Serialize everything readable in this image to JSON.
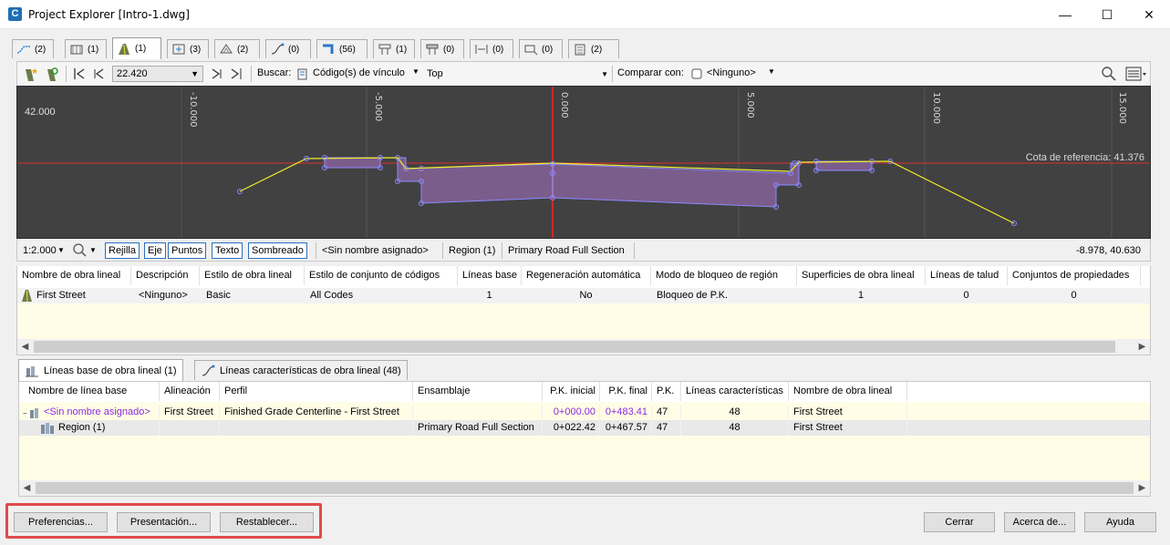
{
  "window": {
    "title": "Project Explorer [Intro-1.dwg]",
    "app_icon": "C"
  },
  "tabs": [
    {
      "icon": "alignment-icon",
      "count": "(2)"
    },
    {
      "icon": "profile-view-icon",
      "count": "(1)"
    },
    {
      "icon": "corridor-icon",
      "count": "(1)"
    },
    {
      "icon": "assembly-icon",
      "count": "(3)"
    },
    {
      "icon": "surface-icon",
      "count": "(2)"
    },
    {
      "icon": "feature-line-icon",
      "count": "(0)"
    },
    {
      "icon": "point-icon",
      "count": "(56)"
    },
    {
      "icon": "pipe-network-icon",
      "count": "(1)"
    },
    {
      "icon": "pressure-network-icon",
      "count": "(0)"
    },
    {
      "icon": "sample-line-icon",
      "count": "(0)"
    },
    {
      "icon": "parcel-icon",
      "count": "(0)"
    },
    {
      "icon": "catalog-icon",
      "count": "(2)"
    }
  ],
  "toolbar": {
    "station_value": "22.420",
    "search_label": "Buscar:",
    "search_mode": "Código(s) de vínculo",
    "search_value": "Top",
    "compare_label": "Comparar con:",
    "compare_value": "<Ninguno>"
  },
  "viewer": {
    "axis_labels": [
      "-10.000",
      "-5.000",
      "0.000",
      "5.000",
      "10.000",
      "15.000"
    ],
    "elevation_label": "42.000",
    "reference_label": "Cota de referencia: 41.376"
  },
  "viewbar": {
    "scale": "1:2.000",
    "toggles": [
      "Rejilla",
      "Eje",
      "Puntos",
      "Texto",
      "Sombreado"
    ],
    "baseline": "<Sin nombre asignado>",
    "region": "Region (1)",
    "assembly": "Primary Road Full Section",
    "coords": "-8.978, 40.630"
  },
  "corridor_table": {
    "headers": [
      "Nombre de obra lineal",
      "Descripción",
      "Estilo de obra lineal",
      "Estilo de conjunto de códigos",
      "Líneas base",
      "Regeneración automática",
      "Modo de bloqueo de región",
      "Superficies de obra lineal",
      "Líneas de talud",
      "Conjuntos de propiedades"
    ],
    "rows": [
      [
        "First Street",
        "<Ninguno>",
        "Basic",
        "All Codes",
        "1",
        "No",
        "Bloqueo de P.K.",
        "1",
        "0",
        "0"
      ]
    ]
  },
  "lower_tabs": [
    {
      "label": "Líneas base de obra lineal (1)"
    },
    {
      "label": "Líneas características de obra lineal (48)"
    }
  ],
  "baseline_table": {
    "headers": [
      "Nombre de línea base",
      "Alineación",
      "Perfil",
      "Ensamblaje",
      "P.K. inicial",
      "P.K. final",
      "P.K.",
      "Líneas características",
      "Nombre de obra lineal"
    ],
    "rows": [
      [
        "<Sin nombre asignado>",
        "First Street",
        "Finished Grade Centerline - First Street",
        "",
        "0+000.00",
        "0+483.41",
        "47",
        "48",
        "First Street"
      ],
      [
        "Region (1)",
        "",
        "",
        "Primary Road Full Section",
        "0+022.42",
        "0+467.57",
        "47",
        "48",
        "First Street"
      ]
    ]
  },
  "buttons": {
    "preferences": "Preferencias...",
    "presentation": "Presentación...",
    "reset": "Restablecer...",
    "close": "Cerrar",
    "about": "Acerca de...",
    "help": "Ayuda"
  },
  "colors": {
    "viewer_bg": "#414141",
    "reference_line": "#e0302e",
    "center_line": "#ff2020",
    "surface_line": "#f4ee2b",
    "region_fill": "#7b5d8c",
    "node_stroke": "#8a8aff",
    "purple_text": "#8a2be2",
    "row_yellow": "#fffde6",
    "highlight": "#e04a4a"
  }
}
